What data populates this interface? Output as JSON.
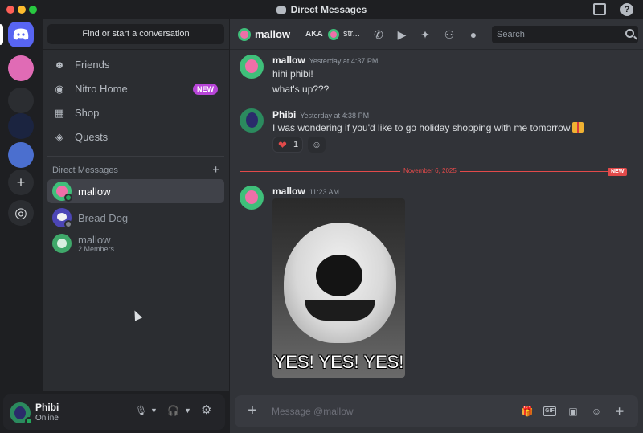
{
  "window": {
    "title": "Direct Messages"
  },
  "sidebar": {
    "find_button": "Find or start a conversation",
    "nav": [
      {
        "label": "Friends",
        "icon": "friends-icon"
      },
      {
        "label": "Nitro Home",
        "icon": "nitro-icon",
        "badge": "NEW"
      },
      {
        "label": "Shop",
        "icon": "shop-icon"
      },
      {
        "label": "Quests",
        "icon": "quests-icon"
      }
    ],
    "dm_header": "Direct Messages",
    "dms": [
      {
        "name": "mallow",
        "status": "online",
        "active": true
      },
      {
        "name": "Bread Dog",
        "status": "offline"
      },
      {
        "name": "mallow",
        "subtitle": "2 Members"
      }
    ]
  },
  "user_panel": {
    "name": "Phibi",
    "status": "Online"
  },
  "chat": {
    "header_name": "mallow",
    "aka_label": "AKA",
    "aka_name": "str...",
    "search_placeholder": "Search",
    "messages": [
      {
        "author": "mallow",
        "timestamp": "Yesterday at 4:37 PM",
        "lines": [
          "hihi phibi!",
          "what's up???"
        ]
      },
      {
        "author": "Phibi",
        "timestamp": "Yesterday at 4:38 PM",
        "lines": [
          "I was wondering if you'd like to go holiday shopping with me tomorrow"
        ],
        "reaction": {
          "emoji": "❤",
          "count": "1"
        }
      },
      {
        "author": "mallow",
        "timestamp": "11:23 AM",
        "gif_caption": "YES! YES! YES!"
      }
    ],
    "date_divider": "November 6, 2025",
    "new_label": "NEW",
    "composer_placeholder": "Message @mallow",
    "gif_button": "GIF"
  },
  "colors": {
    "accent": "#5865f2",
    "online": "#23a55a",
    "new_marker": "#e24a4a",
    "nitro_badge": "#b845d8"
  }
}
